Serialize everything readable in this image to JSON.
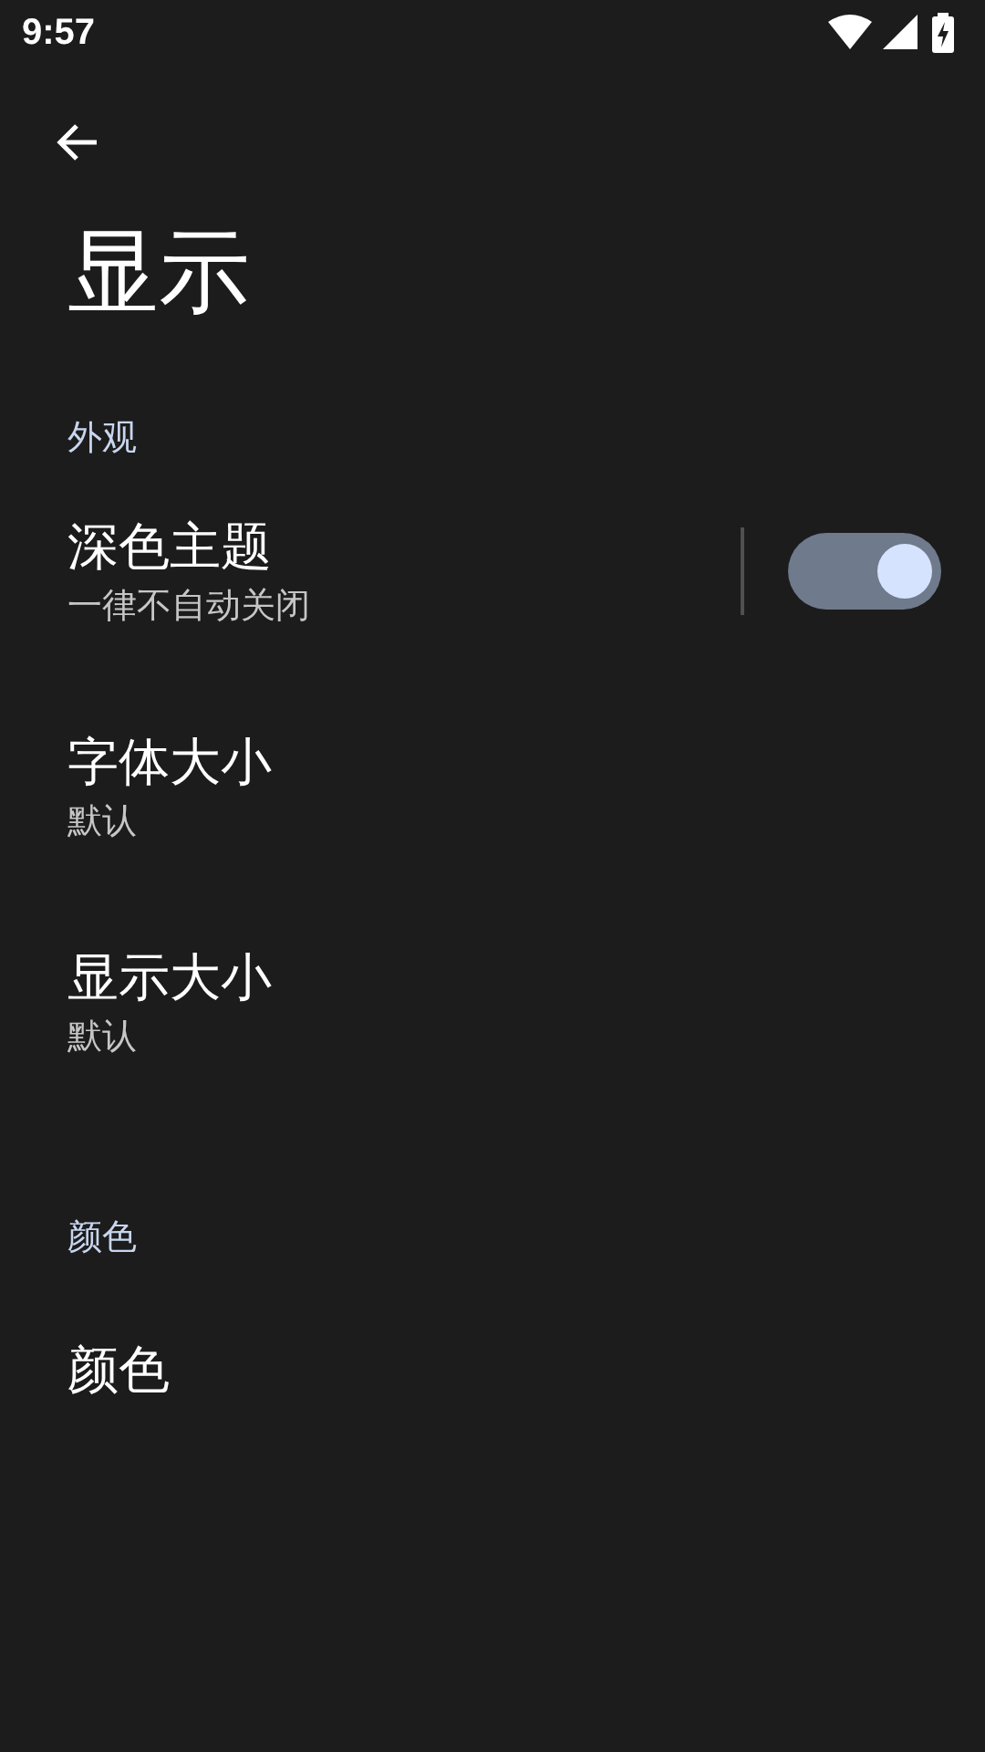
{
  "status_bar": {
    "time": "9:57"
  },
  "title": "显示",
  "sections": [
    {
      "header": "外观",
      "items": [
        {
          "kind": "switch",
          "title": "深色主题",
          "summary": "一律不自动关闭",
          "on": true
        },
        {
          "kind": "plain",
          "title": "字体大小",
          "summary": "默认"
        },
        {
          "kind": "plain",
          "title": "显示大小",
          "summary": "默认"
        }
      ]
    },
    {
      "header": "颜色",
      "items": [
        {
          "kind": "plain",
          "title": "颜色"
        }
      ]
    }
  ]
}
